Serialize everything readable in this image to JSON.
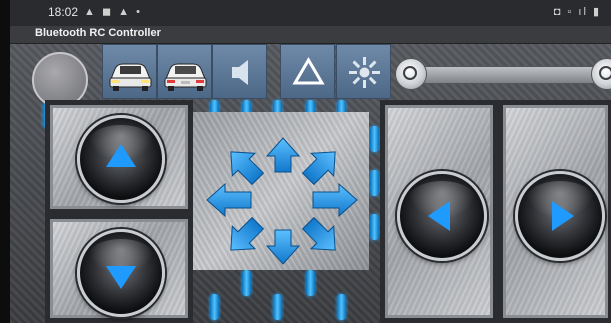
{
  "status_bar": {
    "time": "18:02",
    "left_icons": "▲ ◼ ▲ •",
    "right_icons": "◘ ▫ ıl ▮"
  },
  "app": {
    "title": "Bluetooth RC Controller"
  },
  "toolbar": {
    "buttons": [
      {
        "name": "front-lights",
        "icon": "car-front-icon"
      },
      {
        "name": "rear-lights",
        "icon": "car-rear-icon"
      },
      {
        "name": "horn",
        "icon": "speaker-icon"
      },
      {
        "name": "hazard",
        "icon": "triangle-warning-icon"
      },
      {
        "name": "extra",
        "icon": "gear-sun-icon"
      }
    ],
    "speed_slider": {
      "value": 0
    }
  },
  "controls": {
    "forward": {
      "icon": "arrow-up-icon"
    },
    "backward": {
      "icon": "arrow-down-icon"
    },
    "left": {
      "icon": "arrow-left-icon"
    },
    "right": {
      "icon": "arrow-right-icon"
    }
  },
  "colors": {
    "accent_blue": "#1f9bff",
    "toolbar_blue": "#5f7b9b",
    "metal": "#b9bcc0",
    "frame": "#2b2c30"
  }
}
